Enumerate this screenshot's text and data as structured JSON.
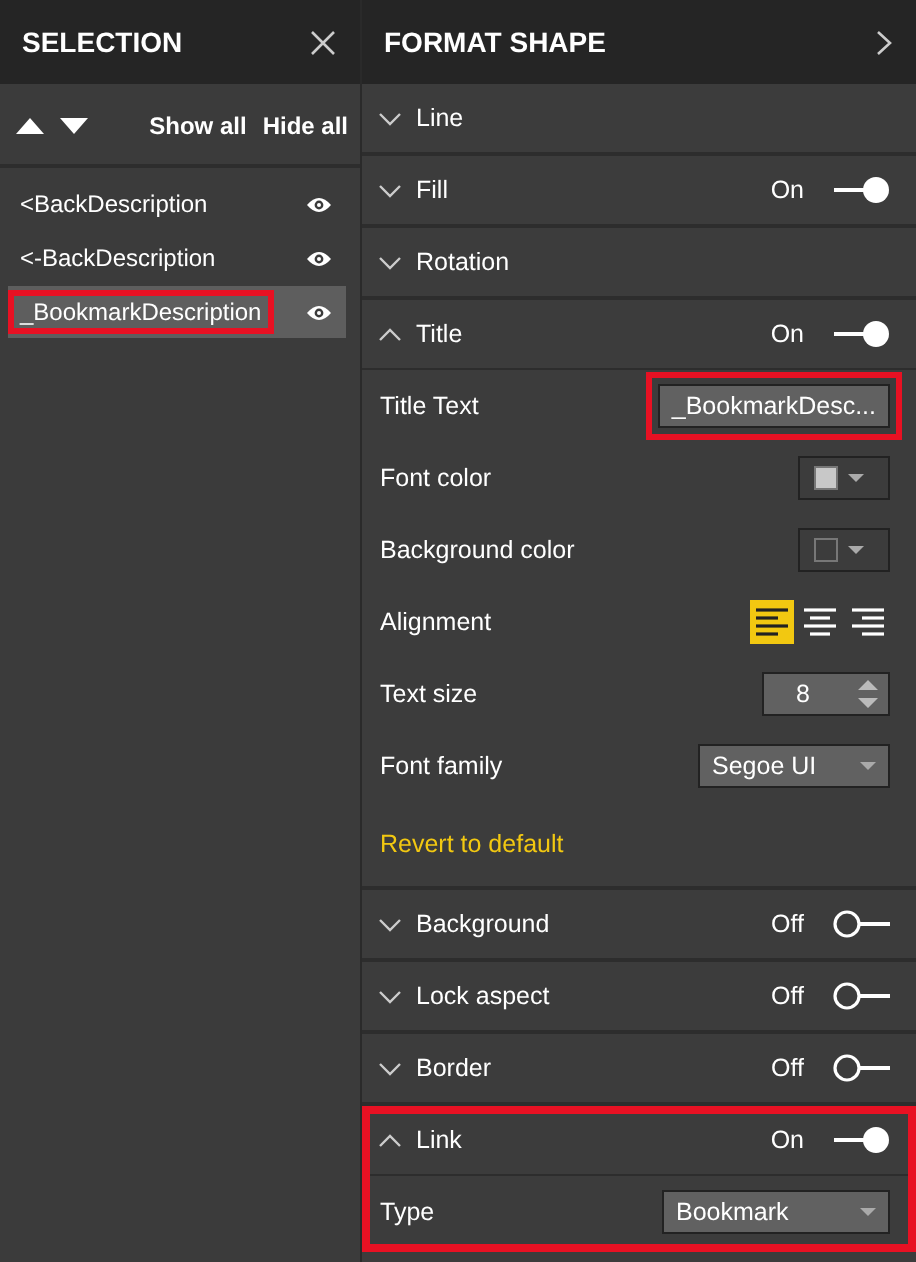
{
  "selection": {
    "title": "SELECTION",
    "show_all": "Show all",
    "hide_all": "Hide all",
    "items": [
      {
        "label": "<BackDescription",
        "selected": false,
        "highlighted": false
      },
      {
        "label": "<-BackDescription",
        "selected": false,
        "highlighted": false
      },
      {
        "label": "_BookmarkDescription",
        "selected": true,
        "highlighted": true
      }
    ]
  },
  "format": {
    "title": "FORMAT SHAPE",
    "sections": [
      {
        "label": "Line",
        "expanded": false,
        "highlighted": false
      },
      {
        "label": "Fill",
        "expanded": false,
        "highlighted": false,
        "toggle": {
          "label": "On",
          "on": true
        }
      },
      {
        "label": "Rotation",
        "expanded": false,
        "highlighted": false
      },
      {
        "label": "Title",
        "expanded": true,
        "highlighted": false,
        "toggle": {
          "label": "On",
          "on": true
        },
        "properties": [
          {
            "kind": "text",
            "label": "Title Text",
            "value": "_BookmarkDesc...",
            "highlighted": true
          },
          {
            "kind": "color",
            "label": "Font color",
            "color": "#c8c8c8"
          },
          {
            "kind": "color",
            "label": "Background color",
            "color": "#3c3c3c"
          },
          {
            "kind": "alignment",
            "label": "Alignment",
            "options": [
              {
                "kind": "left",
                "selected": true
              },
              {
                "kind": "center",
                "selected": false
              },
              {
                "kind": "right",
                "selected": false
              }
            ]
          },
          {
            "kind": "number",
            "label": "Text size",
            "value": "8"
          },
          {
            "kind": "dropdown",
            "label": "Font family",
            "value": "Segoe UI"
          },
          {
            "kind": "link",
            "label": "Revert to default"
          }
        ]
      },
      {
        "label": "Background",
        "expanded": false,
        "highlighted": false,
        "toggle": {
          "label": "Off",
          "on": false
        }
      },
      {
        "label": "Lock aspect",
        "expanded": false,
        "highlighted": false,
        "toggle": {
          "label": "Off",
          "on": false
        }
      },
      {
        "label": "Border",
        "expanded": false,
        "highlighted": false,
        "toggle": {
          "label": "Off",
          "on": false
        }
      },
      {
        "label": "Link",
        "expanded": true,
        "highlighted": true,
        "toggle": {
          "label": "On",
          "on": true
        },
        "properties": [
          {
            "kind": "dropdown",
            "label": "Type",
            "value": "Bookmark"
          }
        ]
      }
    ]
  }
}
